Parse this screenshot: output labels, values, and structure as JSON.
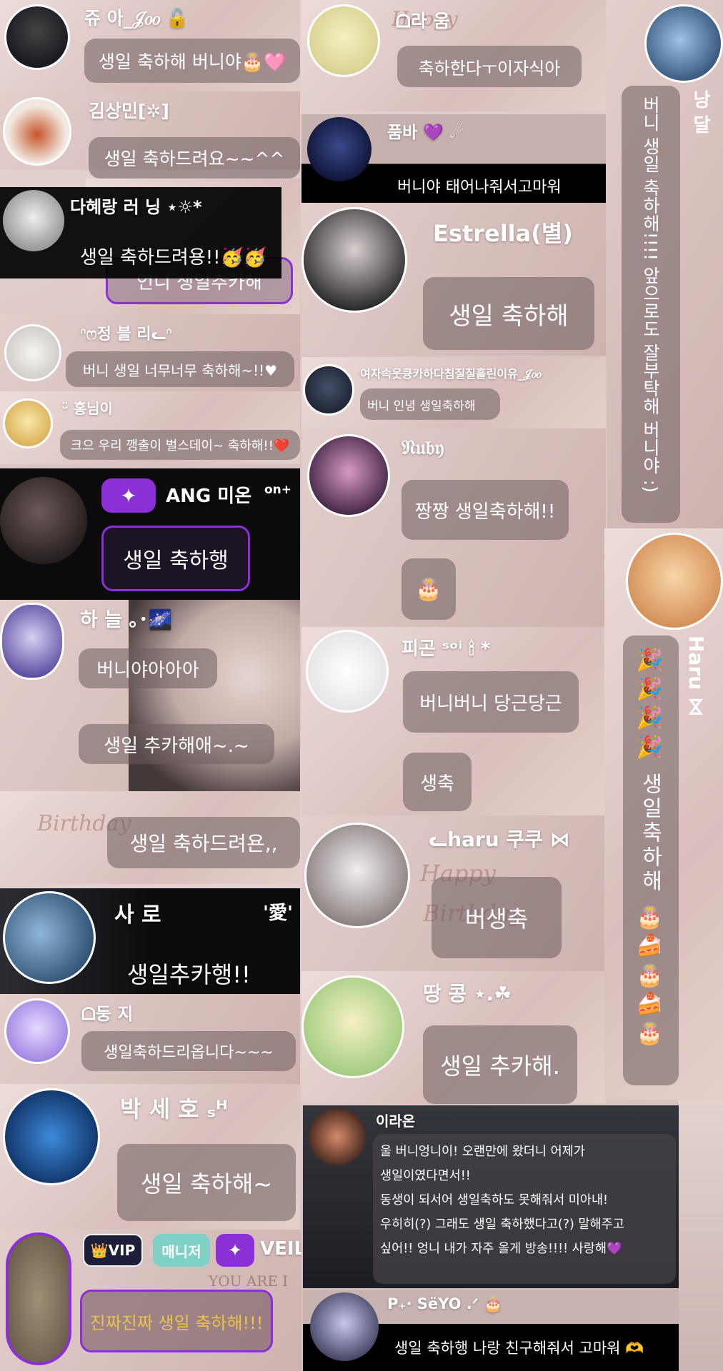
{
  "colors": {
    "bubble": "#6e5c5c",
    "purple": "#8b2fd6",
    "mint": "#7fd1c6",
    "gold": "#e9c34a",
    "white": "#ffffff"
  },
  "deco": {
    "happy": "Happy",
    "birthday": "Birthday",
    "you_are": "YOU ARE I"
  },
  "msg01": {
    "name": "쥬 아_𝒥𝑜𝑜 🔓",
    "text": "생일 축하해 버니야🎂🩷"
  },
  "msg02": {
    "name": "ᗝ라 움",
    "text": "축하한다ㅜ이자식아"
  },
  "msg03": {
    "name": "낭 달",
    "text": "버니 생일 축하해!!!! 앞으로도 잘부탁해 버니야 :)"
  },
  "msg04": {
    "name": "김상민[✲]",
    "text": "생일 축하드려요~~^^"
  },
  "msg05": {
    "name": "품바 💜 ☄",
    "text": "버니야 태어나줘서고마워"
  },
  "msg06": {
    "name": "다혜랑 러 닝 ⋆☼*",
    "text": "생일 축하드려용!!🥳🥳",
    "behind_text": "언니 생일추카해"
  },
  "msg07": {
    "name": "Estrella(별)",
    "text": "생일 축하해"
  },
  "msg08": {
    "name": "ᐢෆ정 블 리ᓚᐢ",
    "text": "버니 생일 너무너무 축하해~!!♥"
  },
  "msg09": {
    "name": "여자속웃큥카하다침질질흘린이유_𝒥𝑜𝑜",
    "text": "버니 인녕 생일축하해"
  },
  "msg10": {
    "name": "ᵕ̈ 홍님이",
    "text": "크으 우리 깽출이 벌스데이~ 축하해!!❤️"
  },
  "msg11": {
    "name": "𝔑𝔲𝔟𝔶",
    "text": "짱짱 생일축하해!!"
  },
  "msg12": {
    "badge": "✦",
    "name": "ANG 미온",
    "suffix": "on+",
    "text": "생일 축하행"
  },
  "msg13": {
    "text": "🎂"
  },
  "msg14": {
    "name": "Haru ⋈",
    "text": "🎉🎉🎉🎉 생일축하해 🎂🍰🎂🍰🎂"
  },
  "msg15": {
    "name": "하 늘 ｡･🌌",
    "text1": "버니야아아아",
    "text2": "생일 추카해애~.~"
  },
  "msg16": {
    "name": "피곤 ˢᵒⁱ 🕯 *",
    "text1": "버니버니 당근당근",
    "text2": "생축"
  },
  "msg17": {
    "text": "생일 축하드려욘,,"
  },
  "msg18": {
    "name": "ᓚharu 쿠쿠 ⋈",
    "text": "버생축"
  },
  "msg19": {
    "name": "사 로",
    "tag": "'愛'",
    "text": "생일추카행!!"
  },
  "msg20": {
    "name": "ᗝ둥 지",
    "text": "생일축하드리옵니다~~~"
  },
  "msg21": {
    "name": "땅 콩 ⋆.☘",
    "text": "생일 추카해."
  },
  "msg22": {
    "name": "박 세 호 ₛᴴ",
    "text": "생일 축하해~"
  },
  "msg23": {
    "name": "이라온",
    "lines": [
      "울 버니엉니이! 오랜만에 왔더니 어제가",
      "생일이였다면서!!",
      "동생이 되서어 생일축하도 못해줘서 미아내!",
      "우히히(?) 그래도 생일 축하했다고(?) 말해주고",
      "싶어!! 엉니 내가 자주 올게 방송!!!! 사랑해💜"
    ]
  },
  "msg24": {
    "badges": {
      "vip": "👑VIP",
      "manager": "매니저",
      "star": "✦",
      "veil": "VEIL"
    },
    "text": "진짜진짜 생일 축하해!!!"
  },
  "msg25": {
    "name": "P₊· SëYO .ᐟ 🎂",
    "text": "생일 축하행 나랑 친구해줘서 고마워 🫶"
  }
}
